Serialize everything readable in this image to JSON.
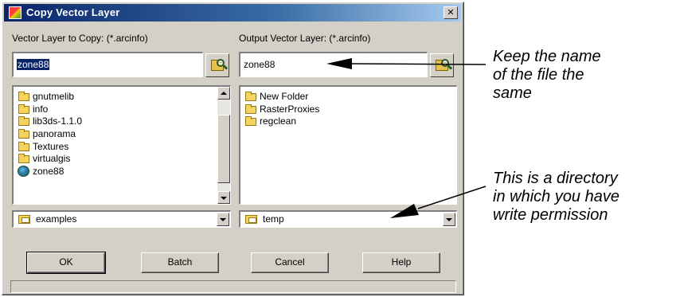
{
  "window": {
    "title": "Copy Vector Layer",
    "close_glyph": "✕"
  },
  "left_pane": {
    "label": "Vector Layer to Copy: (*.arcinfo)",
    "field_value": "zone88",
    "items": [
      {
        "label": "gnutmelib",
        "icon": "folder-icon"
      },
      {
        "label": "info",
        "icon": "folder-icon"
      },
      {
        "label": "lib3ds-1.1.0",
        "icon": "folder-icon"
      },
      {
        "label": "panorama",
        "icon": "folder-icon"
      },
      {
        "label": "Textures",
        "icon": "folder-icon"
      },
      {
        "label": "virtualgis",
        "icon": "folder-icon"
      },
      {
        "label": "zone88",
        "icon": "vector-layer-icon"
      }
    ],
    "directory": "examples"
  },
  "right_pane": {
    "label": "Output Vector Layer: (*.arcinfo)",
    "field_value": "zone88",
    "items": [
      {
        "label": "New Folder",
        "icon": "folder-icon"
      },
      {
        "label": "RasterProxies",
        "icon": "folder-icon"
      },
      {
        "label": "regclean",
        "icon": "folder-icon"
      }
    ],
    "directory": "temp"
  },
  "buttons": {
    "ok": "OK",
    "batch": "Batch",
    "cancel": "Cancel",
    "help": "Help"
  },
  "annotations": {
    "name_note": [
      "Keep the name",
      "of the file the",
      "same"
    ],
    "dir_note": [
      "This is a directory",
      "in which you have",
      "write permission"
    ]
  }
}
